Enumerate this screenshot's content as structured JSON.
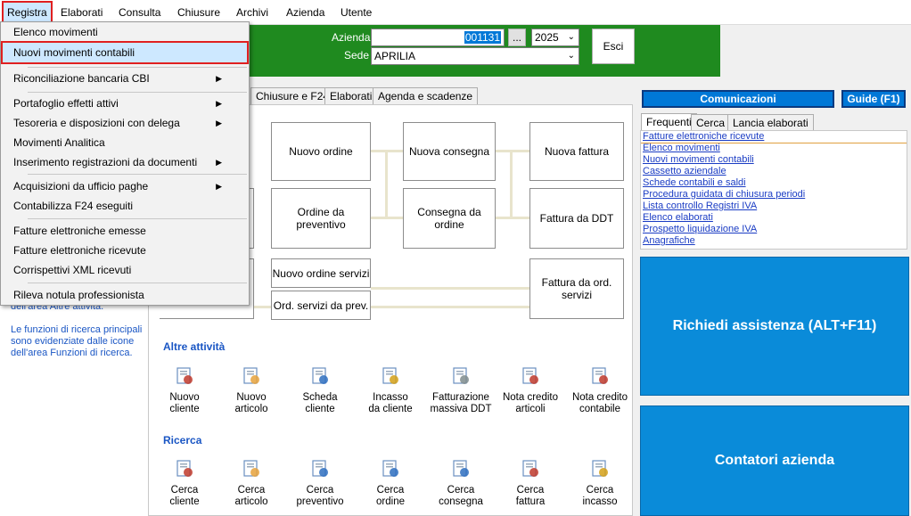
{
  "menubar": {
    "items": [
      "Registra",
      "Elaborati",
      "Consulta",
      "Chiusure",
      "Archivi",
      "Azienda",
      "Utente"
    ]
  },
  "header": {
    "azienda_label": "Azienda",
    "azienda_value": "001131",
    "browse_label": "...",
    "year_value": "2025",
    "sede_label": "Sede",
    "sede_value": "APRILIA",
    "exit_label": "Esci"
  },
  "dropdown": {
    "items": [
      {
        "label": "Elenco movimenti"
      },
      {
        "label": "Nuovi movimenti contabili"
      },
      {
        "label": "Riconciliazione bancaria CBI"
      },
      {
        "label": "Portafoglio effetti attivi"
      },
      {
        "label": "Tesoreria e disposizioni con delega"
      },
      {
        "label": "Movimenti Analitica"
      },
      {
        "label": "Inserimento registrazioni da documenti"
      },
      {
        "label": "Acquisizioni da ufficio paghe"
      },
      {
        "label": "Contabilizza F24 eseguiti"
      },
      {
        "label": "Fatture elettroniche emesse"
      },
      {
        "label": "Fatture elettroniche ricevute"
      },
      {
        "label": "Corrispettivi XML ricevuti"
      },
      {
        "label": "Rileva notula professionista"
      }
    ]
  },
  "tabs": [
    "Chiusure e F24",
    "Elaborati",
    "Agenda e scadenze"
  ],
  "flow": {
    "nuovo_ordine": "Nuovo ordine",
    "nuova_consegna": "Nuova consegna",
    "nuova_fattura": "Nuova fattura",
    "ordine_da_preventivo": "Ordine da preventivo",
    "consegna_da_ordine": "Consegna da ordine",
    "fattura_da_ddt": "Fattura da DDT",
    "nuovo_ordine_servizi": "Nuovo ordine servizi",
    "ord_servizi_da_prev": "Ord. servizi da prev.",
    "fattura_da_ord_servizi": "Fattura da ord. servizi"
  },
  "left_info": {
    "line1": "dell'area Altre attività.",
    "line2": "Le funzioni di ricerca principali sono evidenziate dalle icone dell'area Funzioni di ricerca."
  },
  "altre_attivita": {
    "title": "Altre attività",
    "items": [
      {
        "l1": "Nuovo",
        "l2": "cliente",
        "icon": "new-client-icon"
      },
      {
        "l1": "Nuovo",
        "l2": "articolo",
        "icon": "new-item-icon"
      },
      {
        "l1": "Scheda",
        "l2": "cliente",
        "icon": "client-sheet-icon"
      },
      {
        "l1": "Incasso",
        "l2": "da cliente",
        "icon": "coins-icon"
      },
      {
        "l1": "Fatturazione",
        "l2": "massiva DDT",
        "icon": "batch-invoice-icon"
      },
      {
        "l1": "Nota credito",
        "l2": "articoli",
        "icon": "credit-note-icon"
      },
      {
        "l1": "Nota credito",
        "l2": "contabile",
        "icon": "credit-note-account-icon"
      }
    ]
  },
  "ricerca": {
    "title": "Ricerca",
    "items": [
      {
        "l1": "Cerca",
        "l2": "cliente",
        "icon": "search-client-icon"
      },
      {
        "l1": "Cerca",
        "l2": "articolo",
        "icon": "search-item-icon"
      },
      {
        "l1": "Cerca",
        "l2": "preventivo",
        "icon": "search-quote-icon"
      },
      {
        "l1": "Cerca",
        "l2": "ordine",
        "icon": "search-order-icon"
      },
      {
        "l1": "Cerca",
        "l2": "consegna",
        "icon": "search-delivery-icon"
      },
      {
        "l1": "Cerca",
        "l2": "fattura",
        "icon": "search-invoice-icon"
      },
      {
        "l1": "Cerca",
        "l2": "incasso",
        "icon": "search-payment-icon"
      }
    ]
  },
  "right": {
    "comunicazioni": "Comunicazioni",
    "guide": "Guide (F1)",
    "tabs": [
      "Frequenti",
      "Cerca",
      "Lancia elaborati"
    ],
    "links": [
      "Fatture elettroniche ricevute",
      "Elenco movimenti",
      "Nuovi movimenti contabili",
      "Cassetto aziendale",
      "Schede contabili e saldi",
      "Procedura guidata di chiusura periodi",
      "Lista controllo Registri IVA",
      "Elenco elaborati",
      "Prospetto liquidazione IVA",
      "Anagrafiche"
    ],
    "assistenza": "Richiedi assistenza  (ALT+F11)",
    "contatori": "Contatori azienda"
  }
}
